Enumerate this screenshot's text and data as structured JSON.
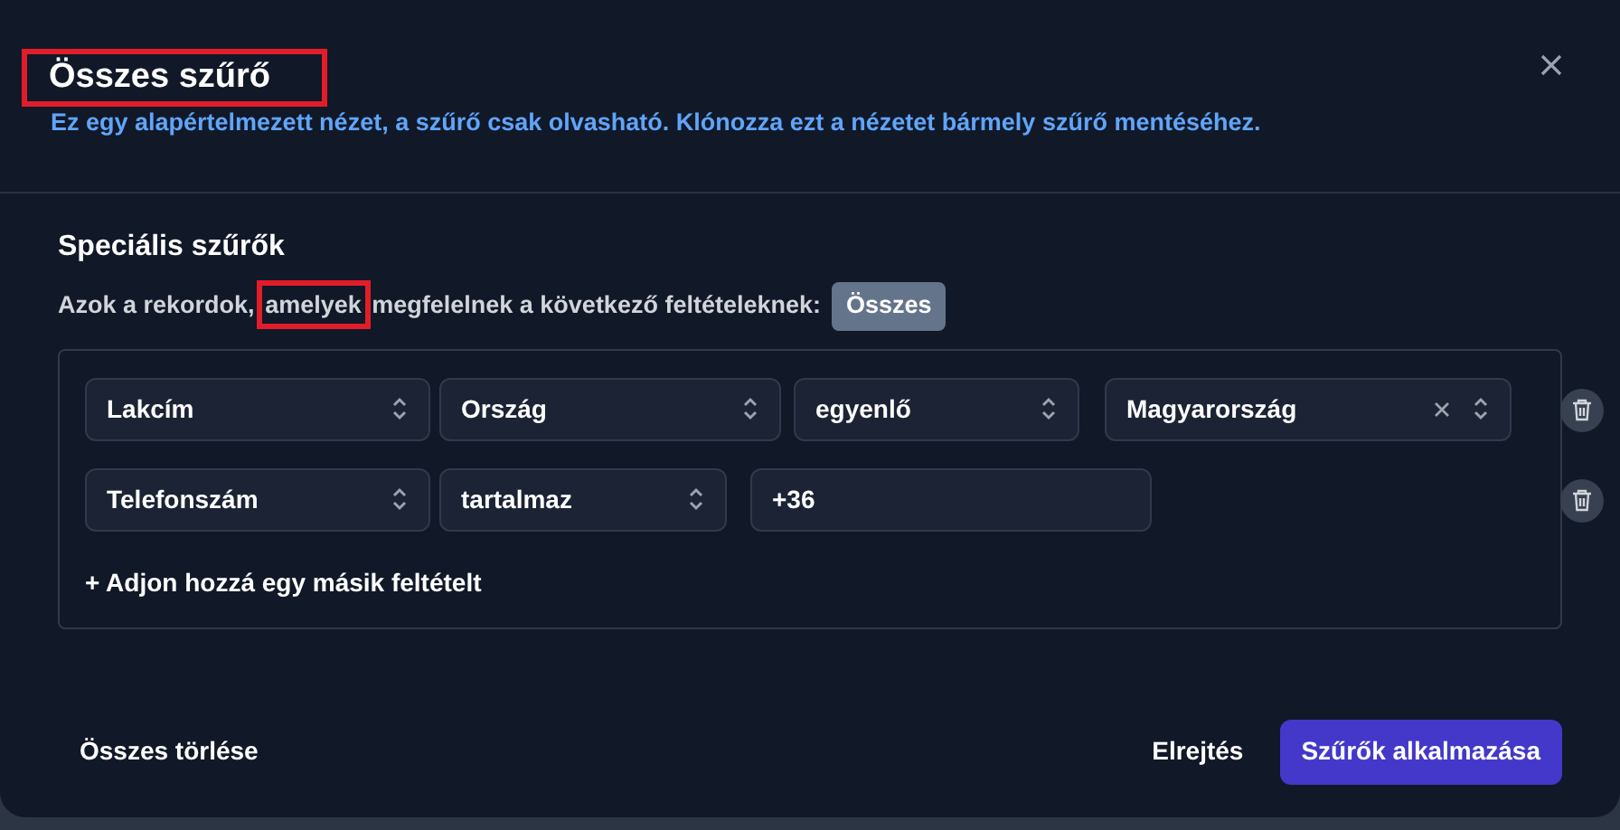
{
  "dialog": {
    "title": "Összes szűrő",
    "title_highlighted": true,
    "subtitle": "Ez egy alapértelmezett nézet, a szűrő csak olvasható. Klónozza ezt a nézetet bármely szűrő mentéséhez."
  },
  "section": {
    "title": "Speciális szűrők",
    "match_text": [
      {
        "text": "Azok a rekordok,",
        "highlighted": false
      },
      {
        "text": "amelyek",
        "highlighted": true
      },
      {
        "text": "megfelelnek a következő feltételeknek:",
        "highlighted": false
      }
    ],
    "match_badge": "Összes"
  },
  "conditions": [
    {
      "fields": [
        {
          "kind": "select",
          "value": "Lakcím"
        },
        {
          "kind": "select",
          "value": "Ország"
        },
        {
          "kind": "select",
          "value": "egyenlő"
        },
        {
          "kind": "clearable_select",
          "value": "Magyarország"
        }
      ]
    },
    {
      "fields": [
        {
          "kind": "select",
          "value": "Telefonszám"
        },
        {
          "kind": "select",
          "value": "tartalmaz"
        },
        {
          "kind": "input",
          "value": "+36"
        }
      ]
    }
  ],
  "add_condition": "+ Adjon hozzá egy másik feltételt",
  "footer": {
    "clear": "Összes törlése",
    "hide": "Elrejtés",
    "apply": "Szűrők alkalmazása"
  }
}
